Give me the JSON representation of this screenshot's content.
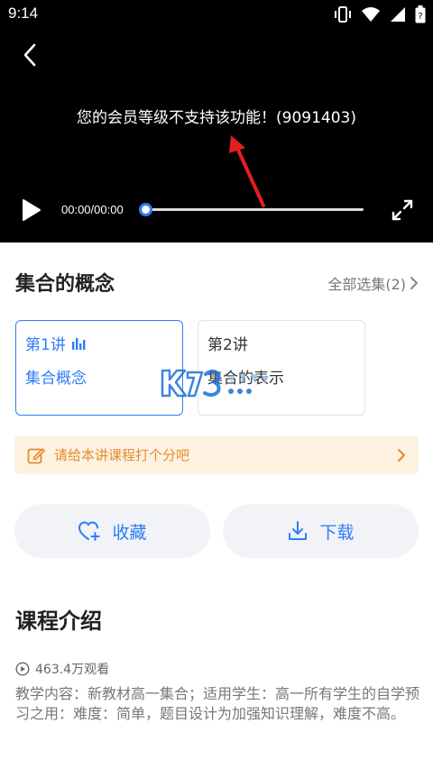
{
  "status_bar": {
    "time": "9:14"
  },
  "player": {
    "error_message": "您的会员等级不支持该功能！(9091403)",
    "time_display": "00:00/00:00",
    "progress": 0
  },
  "course": {
    "title": "集合的概念",
    "all_episodes_label": "全部选集(2)"
  },
  "episodes": [
    {
      "number": "第1讲",
      "name": "集合概念",
      "active": true
    },
    {
      "number": "第2讲",
      "name": "集合的表示",
      "active": false
    }
  ],
  "rating_prompt": "请给本讲课程打个分吧",
  "actions": {
    "collect_label": "收藏",
    "download_label": "下载"
  },
  "intro": {
    "title": "课程介绍",
    "views": "463.4万观看",
    "description": "教学内容：新教材高一集合；适用学生：高一所有学生的自学预习之用：难度：简单，题目设计为加强知识理解，难度不高。"
  },
  "colors": {
    "accent": "#2f7cf6",
    "rating_text": "#e58b2b",
    "rating_bg": "#fdf2e1",
    "annotation_arrow": "#e02020"
  }
}
